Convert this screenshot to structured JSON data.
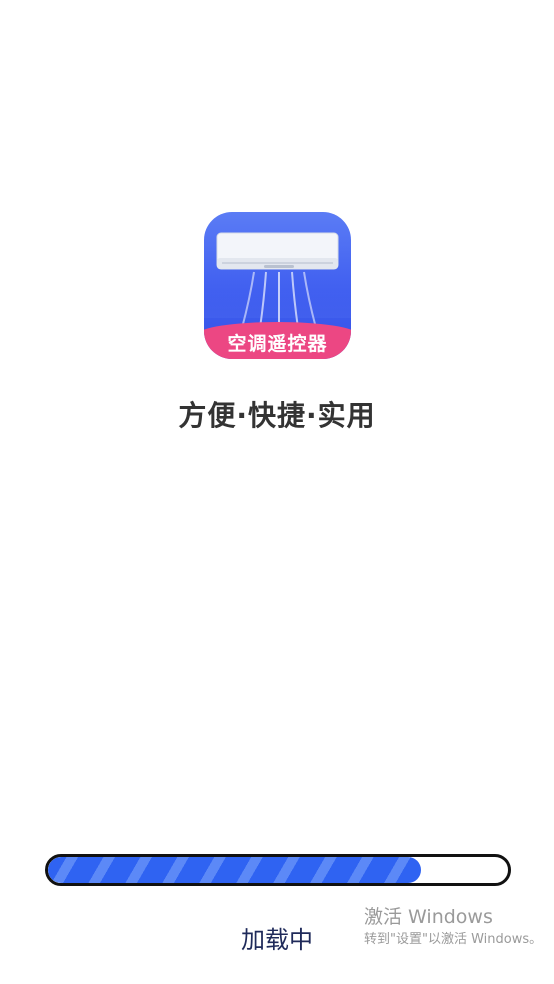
{
  "app": {
    "icon_name": "air-conditioner-icon",
    "icon_label": "空调遥控器",
    "slogan": "方便·快捷·实用",
    "colors": {
      "icon_background": "#3f5ef0",
      "banner": "#ec4783",
      "progress_fill": "#2f63f2",
      "progress_stripe": "#5c89f7",
      "progress_border": "#111111",
      "slogan_text": "#333333",
      "loading_text": "#1f2a5a"
    }
  },
  "loading": {
    "label": "加载中",
    "progress": 0.81
  },
  "watermark": {
    "title": "激活 Windows",
    "subtitle": "转到\"设置\"以激活 Windows。"
  }
}
